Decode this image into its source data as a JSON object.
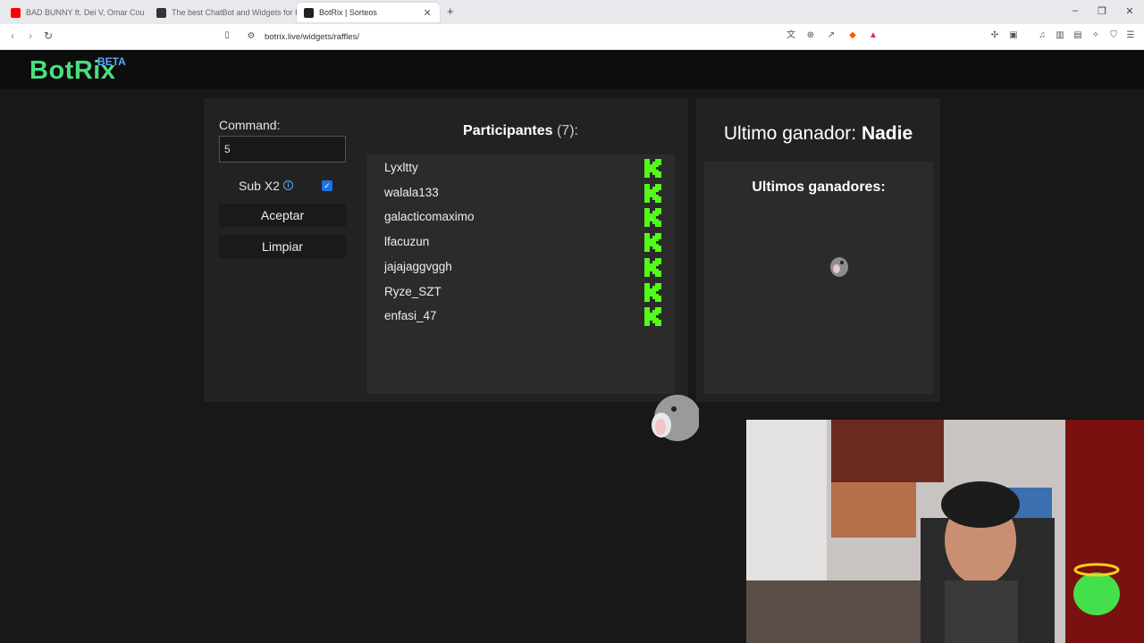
{
  "browser": {
    "tabs": [
      {
        "title": "BAD BUNNY ft. Dei V, Omar Cou",
        "favicon_color": "#ff0000"
      },
      {
        "title": "The best ChatBot and Widgets for K",
        "favicon_color": "#333333"
      },
      {
        "title": "BotRix | Sorteos",
        "favicon_color": "#222222"
      }
    ],
    "url": "botrix.live/widgets/raffles/"
  },
  "brand": {
    "logo": "BotRix",
    "badge": "BETA",
    "accent": "#4ade80"
  },
  "raffle": {
    "command_label": "Command:",
    "command_value": "5",
    "sub_label": "Sub X2",
    "sub_checked": true,
    "accept_label": "Aceptar",
    "clear_label": "Limpiar",
    "participants_title": "Participantes",
    "participants_count": "(7):",
    "participants": [
      "Lyxltty",
      "walala133",
      "galacticomaximo",
      "lfacuzun",
      "jajajaggvggh",
      "Ryze_SZT",
      "enfasi_47"
    ],
    "platform_color": "#53fc18"
  },
  "winners": {
    "last_winner_prefix": "Ultimo ganador:",
    "last_winner_name": "Nadie",
    "list_title": "Ultimos ganadores:"
  },
  "icons": {
    "platform": "kick-icon",
    "info": "info-icon",
    "mascot": "fish-icon"
  }
}
